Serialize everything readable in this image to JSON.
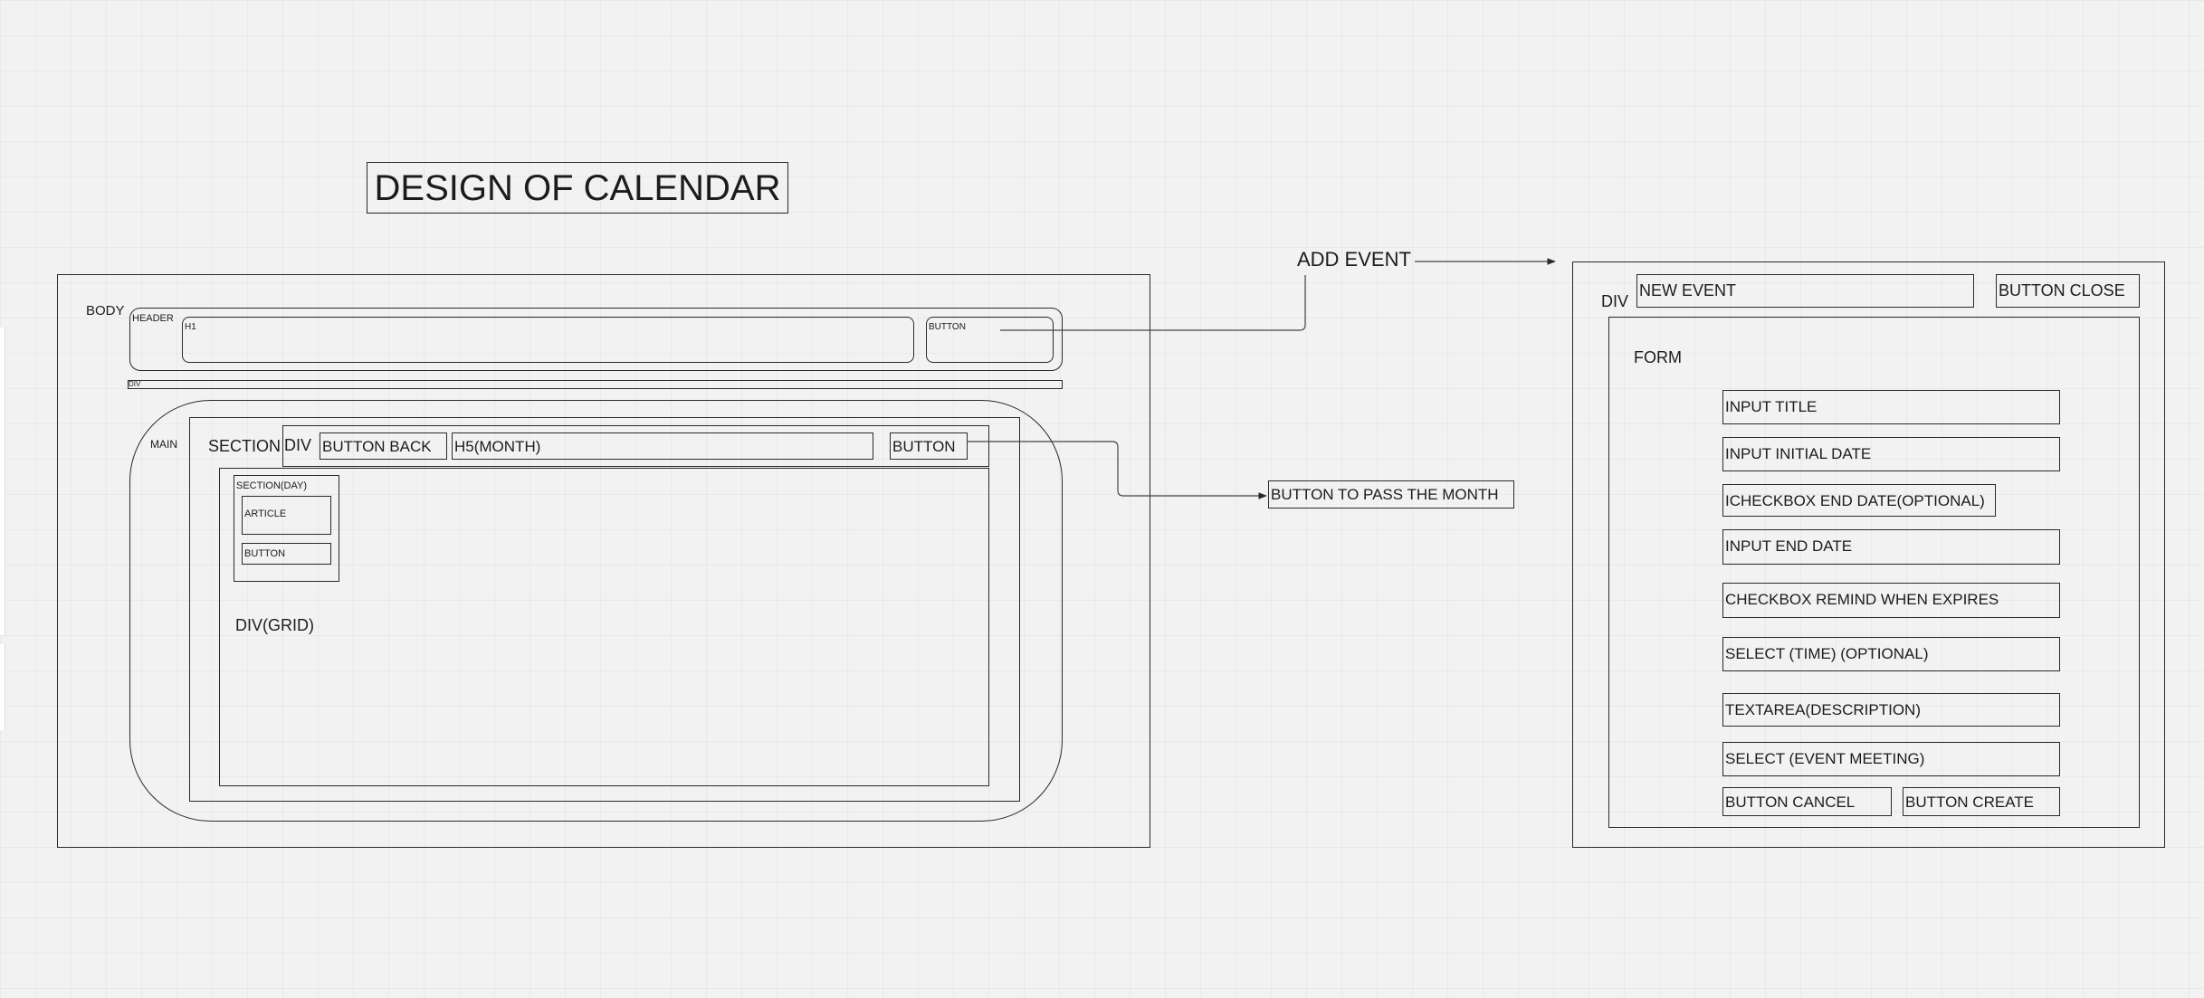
{
  "title": "DESIGN OF CALENDAR",
  "page": {
    "body_label": "BODY",
    "header_label": "HEADER",
    "h1_label": "H1",
    "header_button_label": "BUTTON",
    "div_label": "DIV",
    "main_label": "MAIN",
    "section_label": "SECTION",
    "nav_div_label": "DIV",
    "button_back_label": "BUTTON BACK",
    "h5_label": "H5(MONTH)",
    "nav_button_label": "BUTTON",
    "section_day_label": "SECTION(DAY)",
    "article_label": "ARTICLE",
    "day_button_label": "BUTTON",
    "grid_label": "DIV(GRID)"
  },
  "annotations": {
    "add_event": "ADD EVENT",
    "pass_month": "BUTTON TO PASS THE MONTH"
  },
  "modal": {
    "div_label": "DIV",
    "new_event_label": "NEW EVENT",
    "button_close_label": "BUTTON CLOSE",
    "form_label": "FORM",
    "fields": [
      "INPUT TITLE",
      "INPUT INITIAL DATE",
      "ICHECKBOX END DATE(OPTIONAL)",
      "INPUT END DATE",
      "CHECKBOX REMIND WHEN EXPIRES",
      "SELECT (TIME) (OPTIONAL)",
      "TEXTAREA(DESCRIPTION)",
      "SELECT (EVENT MEETING)"
    ],
    "button_cancel_label": "BUTTON CANCEL",
    "button_create_label": "BUTTON CREATE"
  },
  "colors": {
    "background": "#f2f2f2",
    "stroke": "#2a2a2a",
    "text": "#1c1c1c"
  }
}
